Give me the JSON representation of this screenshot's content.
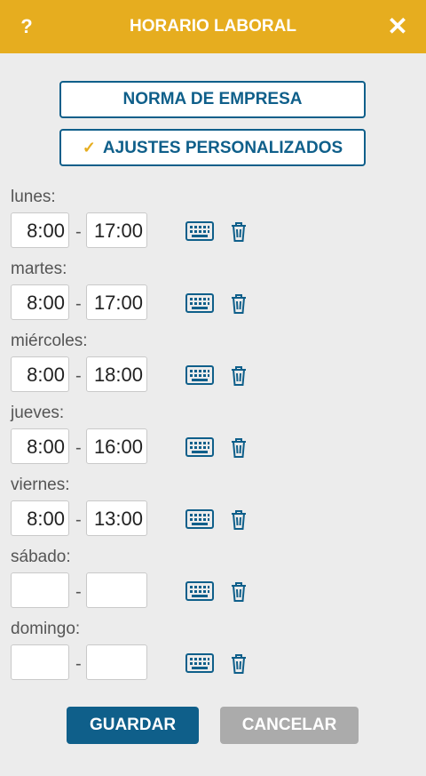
{
  "header": {
    "help": "?",
    "title": "HORARIO LABORAL",
    "close": "✕"
  },
  "options": {
    "company_norm": "NORMA DE EMPRESA",
    "custom": "AJUSTES PERSONALIZADOS",
    "custom_checked": true
  },
  "separator": "-",
  "days": [
    {
      "label": "lunes:",
      "start": "8:00",
      "end": "17:00"
    },
    {
      "label": "martes:",
      "start": "8:00",
      "end": "17:00"
    },
    {
      "label": "miércoles:",
      "start": "8:00",
      "end": "18:00"
    },
    {
      "label": "jueves:",
      "start": "8:00",
      "end": "16:00"
    },
    {
      "label": "viernes:",
      "start": "8:00",
      "end": "13:00"
    },
    {
      "label": "sábado:",
      "start": "",
      "end": ""
    },
    {
      "label": "domingo:",
      "start": "",
      "end": ""
    }
  ],
  "footer": {
    "save": "GUARDAR",
    "cancel": "CANCELAR"
  },
  "colors": {
    "header": "#e6ad1f",
    "accent": "#0f5f8a",
    "cancel": "#ababab",
    "background": "#ececec"
  },
  "icons": {
    "row_edit": "keyboard-icon",
    "row_delete": "trash-icon"
  }
}
